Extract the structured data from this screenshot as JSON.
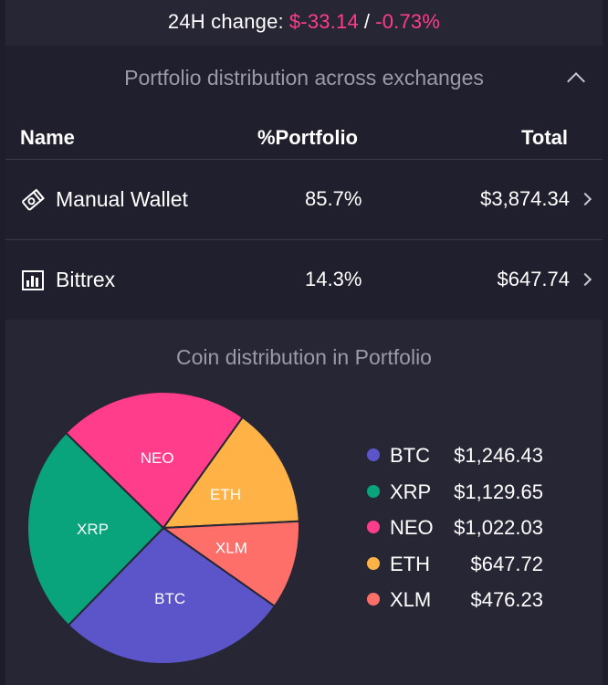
{
  "change": {
    "label": "24H change:",
    "amount": "$-33.14",
    "separator": "/",
    "percent": "-0.73%"
  },
  "exchange_section": {
    "title": "Portfolio distribution across exchanges",
    "columns": {
      "name": "Name",
      "portfolio": "%Portfolio",
      "total": "Total"
    },
    "rows": [
      {
        "icon": "wallet-icon",
        "name": "Manual Wallet",
        "percent": "85.7%",
        "total": "$3,874.34"
      },
      {
        "icon": "bar-chart-icon",
        "name": "Bittrex",
        "percent": "14.3%",
        "total": "$647.74"
      }
    ]
  },
  "coin_section": {
    "title": "Coin distribution in Portfolio"
  },
  "colors": {
    "negative": "#ff3d8a",
    "BTC": "#5c55c9",
    "XRP": "#0aa47c",
    "NEO": "#ff3d8a",
    "ETH": "#ffb347",
    "XLM": "#ff6f6a"
  },
  "chart_data": {
    "type": "pie",
    "categories": [
      "BTC",
      "XRP",
      "NEO",
      "ETH",
      "XLM"
    ],
    "values": [
      1246.43,
      1129.65,
      1022.03,
      647.72,
      476.23
    ],
    "value_labels": [
      "$1,246.43",
      "$1,129.65",
      "$1,022.03",
      "$647.72",
      "$476.23"
    ],
    "legend": "right"
  }
}
